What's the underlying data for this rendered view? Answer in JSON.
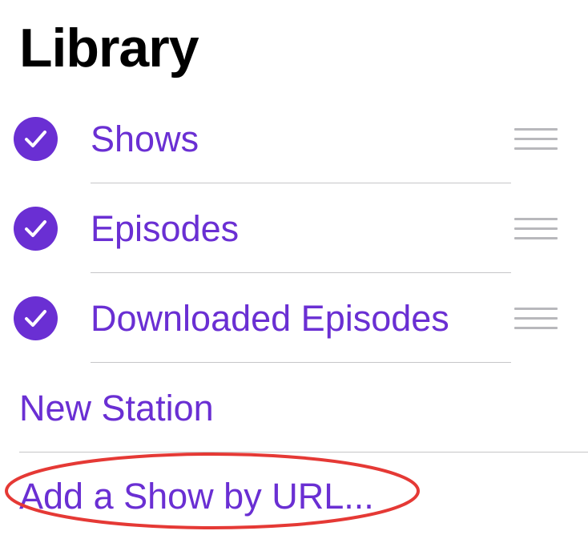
{
  "header": {
    "title": "Library"
  },
  "library_items": [
    {
      "label": "Shows",
      "checked": true
    },
    {
      "label": "Episodes",
      "checked": true
    },
    {
      "label": "Downloaded Episodes",
      "checked": true
    }
  ],
  "actions": {
    "new_station": "New Station",
    "add_show_by_url": "Add a Show by URL..."
  },
  "icons": {
    "checkmark": "checkmark-circle-icon",
    "reorder": "reorder-grip-icon"
  },
  "colors": {
    "accent": "#6a2fd3",
    "title": "#000000",
    "separator": "#c6c6c8",
    "grip": "#b8b8bc",
    "annotation_ring": "#e53935"
  }
}
